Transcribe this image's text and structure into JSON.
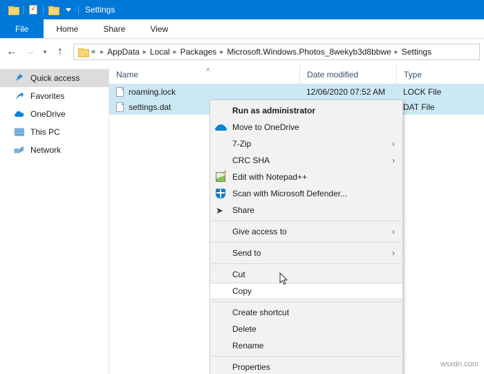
{
  "window": {
    "title": "Settings",
    "quick_access_toolbar": [
      {
        "name": "folder-icon",
        "label": "Folder"
      },
      {
        "name": "properties-icon",
        "label": "Properties"
      },
      {
        "name": "new-folder-icon",
        "label": "New folder"
      },
      {
        "name": "chevron-down-icon",
        "label": "Customize Quick Access Toolbar"
      }
    ],
    "accent_color": "#0078d7"
  },
  "ribbon": {
    "tabs": [
      {
        "label": "File",
        "active": true
      },
      {
        "label": "Home",
        "active": false
      },
      {
        "label": "Share",
        "active": false
      },
      {
        "label": "View",
        "active": false
      }
    ]
  },
  "address_bar": {
    "back_icon": "arrow-left-icon",
    "forward_icon": "arrow-right-icon",
    "recent_icon": "chevron-down-icon",
    "up_icon": "arrow-up-icon",
    "ellipsis": "«",
    "breadcrumbs": [
      "AppData",
      "Local",
      "Packages",
      "Microsoft.Windows.Photos_8wekyb3d8bbwe",
      "Settings"
    ]
  },
  "sidebar": {
    "items": [
      {
        "label": "Quick access",
        "icon": "star-pin-icon",
        "selected": true
      },
      {
        "label": "Favorites",
        "icon": "favorites-arrow-icon",
        "selected": false
      },
      {
        "label": "OneDrive",
        "icon": "onedrive-cloud-icon",
        "selected": false
      },
      {
        "label": "This PC",
        "icon": "this-pc-monitor-icon",
        "selected": false
      },
      {
        "label": "Network",
        "icon": "network-icon",
        "selected": false
      }
    ]
  },
  "file_list": {
    "columns": [
      {
        "label": "Name",
        "sorted": "asc"
      },
      {
        "label": "Date modified",
        "sorted": null
      },
      {
        "label": "Type",
        "sorted": null
      }
    ],
    "sort_glyph": "˄",
    "rows": [
      {
        "name": "roaming.lock",
        "date_modified": "12/06/2020 07:52 AM",
        "type": "LOCK File",
        "selected": true,
        "icon": "generic-file-icon"
      },
      {
        "name": "settings.dat",
        "date_modified": "",
        "type": "DAT File",
        "selected": true,
        "icon": "generic-file-icon"
      }
    ]
  },
  "context_menu": {
    "items": [
      {
        "label": "Run as administrator",
        "bold": true,
        "icon": null,
        "submenu": false,
        "hover": false
      },
      {
        "label": "Move to OneDrive",
        "bold": false,
        "icon": "onedrive-cloud-icon",
        "submenu": false,
        "hover": false
      },
      {
        "label": "7-Zip",
        "bold": false,
        "icon": null,
        "submenu": true,
        "hover": false
      },
      {
        "label": "CRC SHA",
        "bold": false,
        "icon": null,
        "submenu": true,
        "hover": false
      },
      {
        "label": "Edit with Notepad++",
        "bold": false,
        "icon": "notepad-plus-plus-icon",
        "submenu": false,
        "hover": false
      },
      {
        "label": "Scan with Microsoft Defender...",
        "bold": false,
        "icon": "defender-shield-icon",
        "submenu": false,
        "hover": false
      },
      {
        "label": "Share",
        "bold": false,
        "icon": "share-arrow-icon",
        "submenu": false,
        "hover": false
      },
      {
        "separator": true
      },
      {
        "label": "Give access to",
        "bold": false,
        "icon": null,
        "submenu": true,
        "hover": false
      },
      {
        "separator": true
      },
      {
        "label": "Send to",
        "bold": false,
        "icon": null,
        "submenu": true,
        "hover": false
      },
      {
        "separator": true
      },
      {
        "label": "Cut",
        "bold": false,
        "icon": null,
        "submenu": false,
        "hover": false
      },
      {
        "label": "Copy",
        "bold": false,
        "icon": null,
        "submenu": false,
        "hover": true
      },
      {
        "separator": true
      },
      {
        "label": "Create shortcut",
        "bold": false,
        "icon": null,
        "submenu": false,
        "hover": false
      },
      {
        "label": "Delete",
        "bold": false,
        "icon": null,
        "submenu": false,
        "hover": false
      },
      {
        "label": "Rename",
        "bold": false,
        "icon": null,
        "submenu": false,
        "hover": false
      },
      {
        "separator": true
      },
      {
        "label": "Properties",
        "bold": false,
        "icon": null,
        "submenu": false,
        "hover": false
      }
    ],
    "submenu_glyph": "›"
  },
  "watermark": {
    "text": "wsxdn.com"
  }
}
